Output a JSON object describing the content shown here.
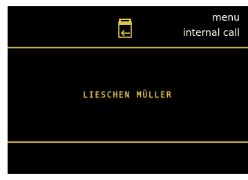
{
  "softkeys": {
    "menu_label": "menu",
    "internal_call_label": "internal call"
  },
  "status": {
    "icon": "door-phone-incoming-icon"
  },
  "caller": {
    "name": "LIESCHEN MÜLLER"
  },
  "colors": {
    "background": "#000000",
    "accent": "#d8c050",
    "text": "#ffffff"
  }
}
